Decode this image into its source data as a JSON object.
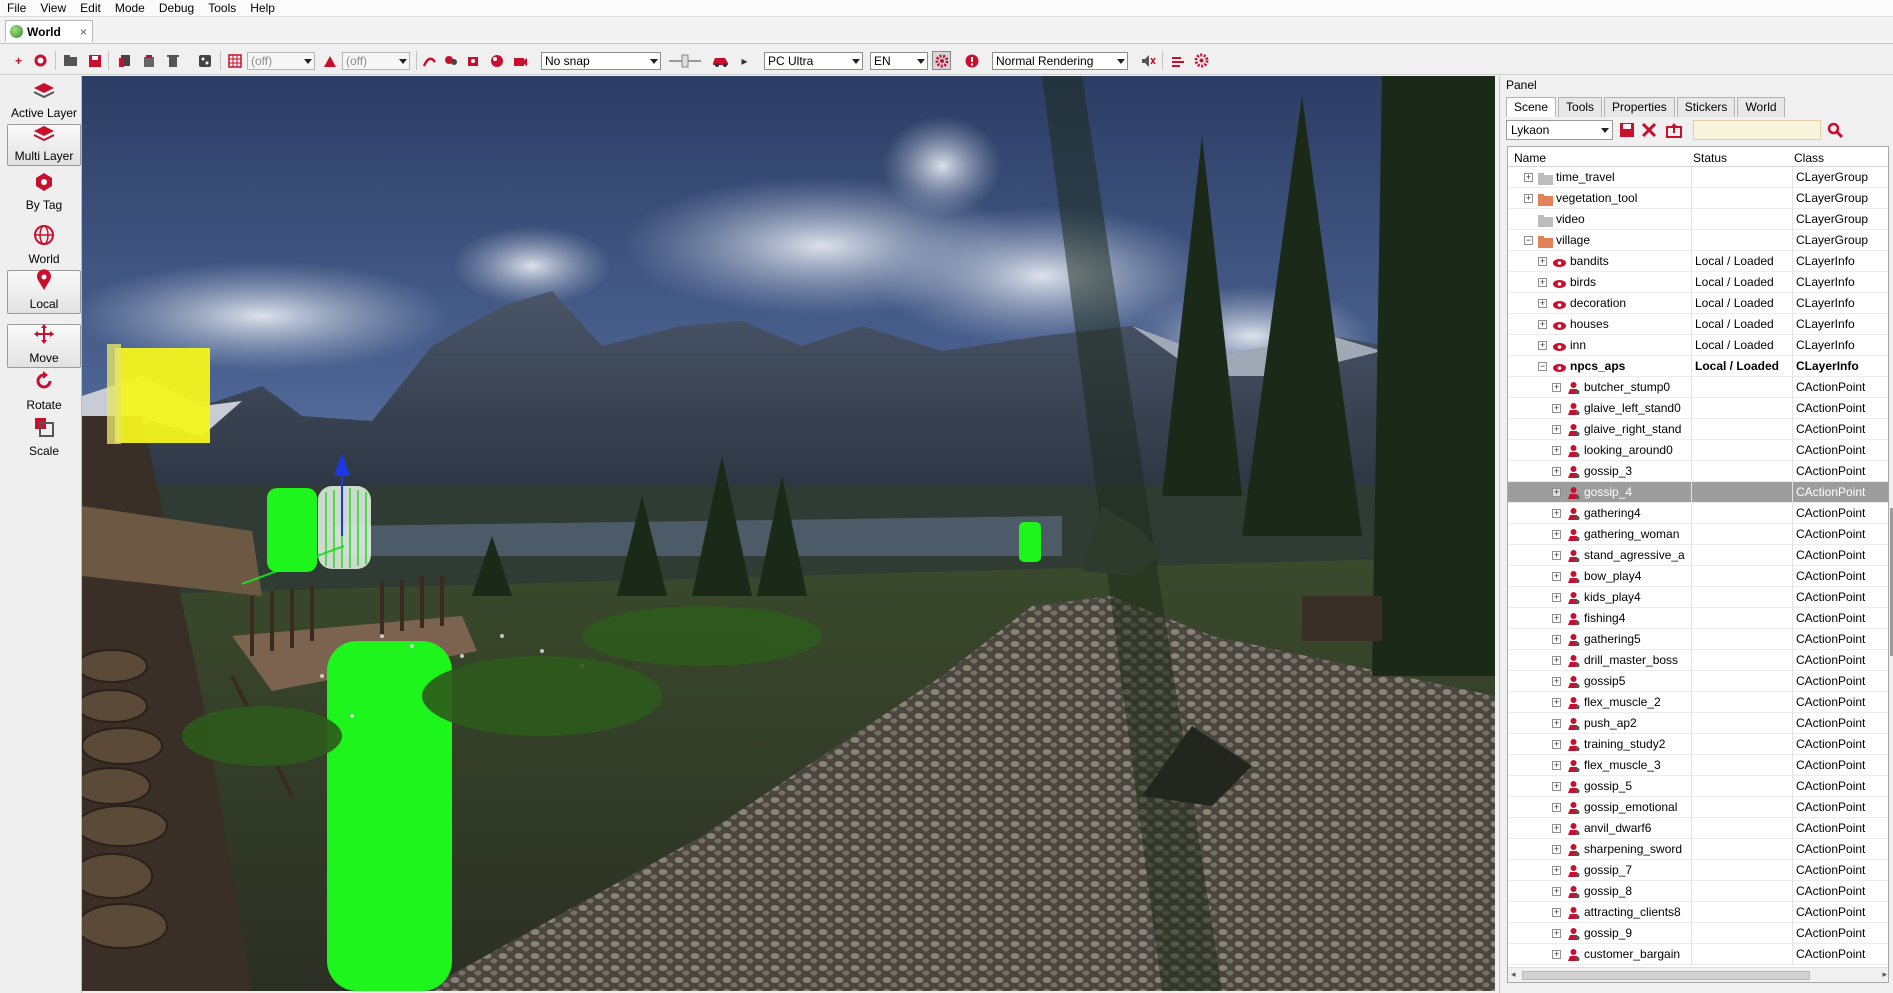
{
  "menu": [
    "File",
    "View",
    "Edit",
    "Mode",
    "Debug",
    "Tools",
    "Help"
  ],
  "doc_tab": {
    "title": "World",
    "close": "×"
  },
  "toolbar": {
    "layer_filter_1": "(off)",
    "layer_filter_2": "(off)",
    "snap": "No snap",
    "platform": "PC Ultra",
    "language": "EN",
    "rendering": "Normal Rendering"
  },
  "left_tools": [
    {
      "label": "Active Layer",
      "icon": "layer-stack-icon",
      "active": false
    },
    {
      "label": "Multi Layer",
      "icon": "multi-layer-icon",
      "active": true
    },
    {
      "label": "By Tag",
      "icon": "tag-gem-icon",
      "active": false
    },
    {
      "label": "World",
      "icon": "globe-icon",
      "active": false
    },
    {
      "label": "Local",
      "icon": "map-pin-icon",
      "active": true
    },
    {
      "label": "Move",
      "icon": "move-arrows-icon",
      "active": true
    },
    {
      "label": "Rotate",
      "icon": "rotate-icon",
      "active": false
    },
    {
      "label": "Scale",
      "icon": "scale-icon",
      "active": false
    }
  ],
  "panel": {
    "title": "Panel",
    "tabs": [
      "Scene",
      "Tools",
      "Properties",
      "Stickers",
      "World"
    ],
    "active_tab": "Scene",
    "world_select": "Lykaon",
    "columns": {
      "name": "Name",
      "status": "Status",
      "class": "Class"
    }
  },
  "tree_rows": [
    {
      "name": "time_travel",
      "status": "",
      "class": "CLayerGroup",
      "level": 1,
      "kind": "folder",
      "expand": "+"
    },
    {
      "name": "vegetation_tool",
      "status": "",
      "class": "CLayerGroup",
      "level": 1,
      "kind": "folder-red",
      "expand": "+"
    },
    {
      "name": "video",
      "status": "",
      "class": "CLayerGroup",
      "level": 1,
      "kind": "folder",
      "expand": ""
    },
    {
      "name": "village",
      "status": "",
      "class": "CLayerGroup",
      "level": 1,
      "kind": "folder-red",
      "expand": "−"
    },
    {
      "name": "bandits",
      "status": "Local / Loaded",
      "class": "CLayerInfo",
      "level": 2,
      "kind": "eye",
      "expand": "+"
    },
    {
      "name": "birds",
      "status": "Local / Loaded",
      "class": "CLayerInfo",
      "level": 2,
      "kind": "eye",
      "expand": "+"
    },
    {
      "name": "decoration",
      "status": "Local / Loaded",
      "class": "CLayerInfo",
      "level": 2,
      "kind": "eye",
      "expand": "+"
    },
    {
      "name": "houses",
      "status": "Local / Loaded",
      "class": "CLayerInfo",
      "level": 2,
      "kind": "eye",
      "expand": "+"
    },
    {
      "name": "inn",
      "status": "Local / Loaded",
      "class": "CLayerInfo",
      "level": 2,
      "kind": "eye",
      "expand": "+"
    },
    {
      "name": "npcs_aps",
      "status": "Local / Loaded",
      "class": "CLayerInfo",
      "level": 2,
      "kind": "eye",
      "expand": "−",
      "bold": true
    },
    {
      "name": "butcher_stump0",
      "status": "",
      "class": "CActionPoint",
      "level": 3,
      "kind": "ap",
      "expand": "+"
    },
    {
      "name": "glaive_left_stand0",
      "status": "",
      "class": "CActionPoint",
      "level": 3,
      "kind": "ap",
      "expand": "+"
    },
    {
      "name": "glaive_right_stand",
      "status": "",
      "class": "CActionPoint",
      "level": 3,
      "kind": "ap",
      "expand": "+"
    },
    {
      "name": "looking_around0",
      "status": "",
      "class": "CActionPoint",
      "level": 3,
      "kind": "ap",
      "expand": "+"
    },
    {
      "name": "gossip_3",
      "status": "",
      "class": "CActionPoint",
      "level": 3,
      "kind": "ap",
      "expand": "+"
    },
    {
      "name": "gossip_4",
      "status": "",
      "class": "CActionPoint",
      "level": 3,
      "kind": "ap",
      "expand": "+",
      "selected": true
    },
    {
      "name": "gathering4",
      "status": "",
      "class": "CActionPoint",
      "level": 3,
      "kind": "ap",
      "expand": "+"
    },
    {
      "name": "gathering_woman",
      "status": "",
      "class": "CActionPoint",
      "level": 3,
      "kind": "ap",
      "expand": "+"
    },
    {
      "name": "stand_agressive_a",
      "status": "",
      "class": "CActionPoint",
      "level": 3,
      "kind": "ap",
      "expand": "+"
    },
    {
      "name": "bow_play4",
      "status": "",
      "class": "CActionPoint",
      "level": 3,
      "kind": "ap",
      "expand": "+"
    },
    {
      "name": "kids_play4",
      "status": "",
      "class": "CActionPoint",
      "level": 3,
      "kind": "ap",
      "expand": "+"
    },
    {
      "name": "fishing4",
      "status": "",
      "class": "CActionPoint",
      "level": 3,
      "kind": "ap",
      "expand": "+"
    },
    {
      "name": "gathering5",
      "status": "",
      "class": "CActionPoint",
      "level": 3,
      "kind": "ap",
      "expand": "+"
    },
    {
      "name": "drill_master_boss",
      "status": "",
      "class": "CActionPoint",
      "level": 3,
      "kind": "ap",
      "expand": "+"
    },
    {
      "name": "gossip5",
      "status": "",
      "class": "CActionPoint",
      "level": 3,
      "kind": "ap",
      "expand": "+"
    },
    {
      "name": "flex_muscle_2",
      "status": "",
      "class": "CActionPoint",
      "level": 3,
      "kind": "ap",
      "expand": "+"
    },
    {
      "name": "push_ap2",
      "status": "",
      "class": "CActionPoint",
      "level": 3,
      "kind": "ap",
      "expand": "+"
    },
    {
      "name": "training_study2",
      "status": "",
      "class": "CActionPoint",
      "level": 3,
      "kind": "ap",
      "expand": "+"
    },
    {
      "name": "flex_muscle_3",
      "status": "",
      "class": "CActionPoint",
      "level": 3,
      "kind": "ap",
      "expand": "+"
    },
    {
      "name": "gossip_5",
      "status": "",
      "class": "CActionPoint",
      "level": 3,
      "kind": "ap",
      "expand": "+"
    },
    {
      "name": "gossip_emotional",
      "status": "",
      "class": "CActionPoint",
      "level": 3,
      "kind": "ap",
      "expand": "+"
    },
    {
      "name": "anvil_dwarf6",
      "status": "",
      "class": "CActionPoint",
      "level": 3,
      "kind": "ap",
      "expand": "+"
    },
    {
      "name": "sharpening_sword",
      "status": "",
      "class": "CActionPoint",
      "level": 3,
      "kind": "ap",
      "expand": "+"
    },
    {
      "name": "gossip_7",
      "status": "",
      "class": "CActionPoint",
      "level": 3,
      "kind": "ap",
      "expand": "+"
    },
    {
      "name": "gossip_8",
      "status": "",
      "class": "CActionPoint",
      "level": 3,
      "kind": "ap",
      "expand": "+"
    },
    {
      "name": "attracting_clients8",
      "status": "",
      "class": "CActionPoint",
      "level": 3,
      "kind": "ap",
      "expand": "+"
    },
    {
      "name": "gossip_9",
      "status": "",
      "class": "CActionPoint",
      "level": 3,
      "kind": "ap",
      "expand": "+"
    },
    {
      "name": "customer_bargain",
      "status": "",
      "class": "CActionPoint",
      "level": 3,
      "kind": "ap",
      "expand": "+"
    }
  ],
  "colors": {
    "accent_red": "#c8102e",
    "selection": "#9d9d9d",
    "marker_green": "#1df51d",
    "marker_yellow": "#f4f41e"
  }
}
